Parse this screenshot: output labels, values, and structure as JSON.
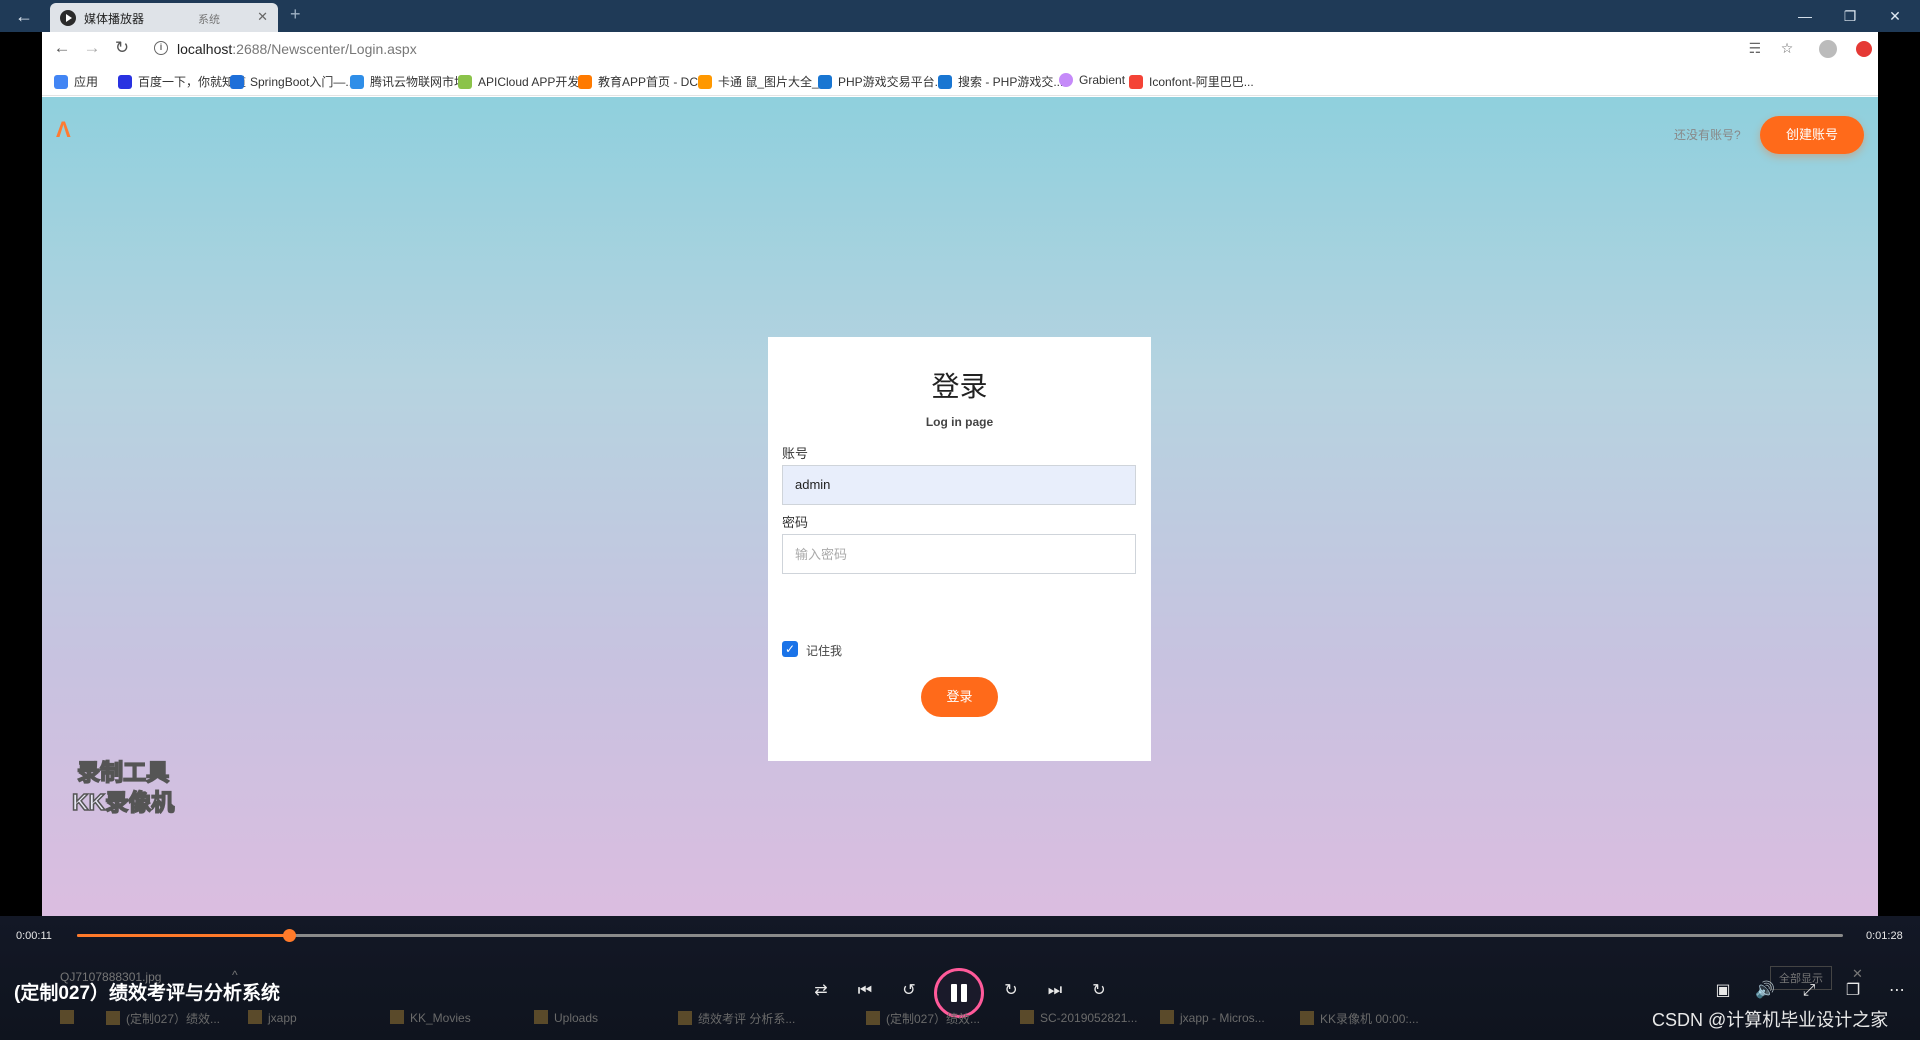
{
  "player": {
    "tab_title": "媒体播放器",
    "tab_sub": "系统",
    "current_time": "0:00:11",
    "total_time": "0:01:28",
    "progress_fraction": 0.12,
    "video_title": "(定制027）绩效考评与分析系统",
    "watermark_line1": "录制工具",
    "watermark_line2": "KK录像机",
    "csdn": "CSDN @计算机毕业设计之家",
    "download_file": "QJ7107888301.jpg",
    "download_show_all": "全部显示"
  },
  "browser": {
    "url_host": "localhost",
    "url_path": ":2688/Newscenter/Login.aspx",
    "bookmarks": [
      {
        "label": "应用",
        "color": "#4285f4"
      },
      {
        "label": "百度一下，你就知道",
        "color": "#2932e1"
      },
      {
        "label": "SpringBoot入门—...",
        "color": "#1e6fd9"
      },
      {
        "label": "腾讯云物联网市场",
        "color": "#2f8ee8"
      },
      {
        "label": "APICloud APP开发...",
        "color": "#8bc34a"
      },
      {
        "label": "教育APP首页 - DCl...",
        "color": "#ff7a00"
      },
      {
        "label": "卡通 鼠_图片大全_...",
        "color": "#ff9800"
      },
      {
        "label": "PHP游戏交易平台...",
        "color": "#1976d2"
      },
      {
        "label": "搜索 - PHP游戏交...",
        "color": "#1976d2"
      },
      {
        "label": "Grabient",
        "color": "#c58af9"
      },
      {
        "label": "Iconfont-阿里巴巴...",
        "color": "#f44336"
      }
    ]
  },
  "page": {
    "logo": "Λ",
    "no_account": "还没有账号?",
    "create_account": "创建账号",
    "login_title": "登录",
    "login_subtitle": "Log in page",
    "account_label": "账号",
    "account_value": "admin",
    "password_label": "密码",
    "password_placeholder": "输入密码",
    "remember_label": "记住我",
    "login_button": "登录"
  },
  "taskbar": [
    {
      "label": "(定制027）绩效..."
    },
    {
      "label": "jxapp"
    },
    {
      "label": "KK_Movies"
    },
    {
      "label": "Uploads"
    },
    {
      "label": "绩效考评 分析系..."
    },
    {
      "label": "(定制027）绩效..."
    },
    {
      "label": "SC-2019052821..."
    },
    {
      "label": "jxapp - Micros..."
    },
    {
      "label": "KK录像机 00:00:..."
    }
  ],
  "colors": {
    "accent": "#ff6a1a",
    "progress": "#ff7a2a",
    "checkbox": "#1a73e8"
  }
}
